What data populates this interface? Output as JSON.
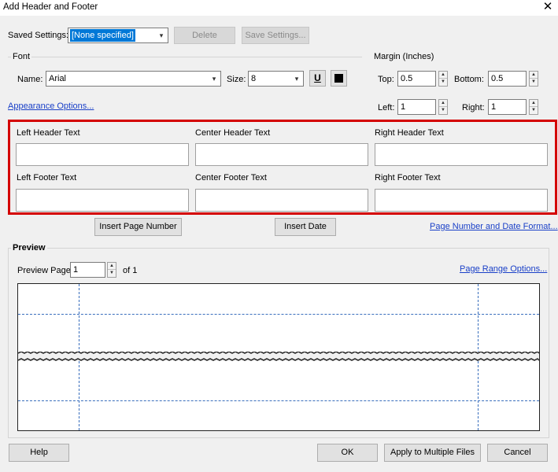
{
  "window": {
    "title": "Add Header and Footer",
    "close_icon": "close-icon"
  },
  "saved_settings": {
    "label": "Saved Settings:",
    "value": "[None specified]",
    "delete_label": "Delete",
    "save_label": "Save Settings..."
  },
  "font": {
    "group_label": "Font",
    "name_label": "Name:",
    "name_value": "Arial",
    "size_label": "Size:",
    "size_value": "8",
    "underline_glyph": "U",
    "color_hex": "#000000"
  },
  "margin": {
    "group_label": "Margin (Inches)",
    "top_label": "Top:",
    "top_value": "0.5",
    "bottom_label": "Bottom:",
    "bottom_value": "0.5",
    "left_label": "Left:",
    "left_value": "1",
    "right_label": "Right:",
    "right_value": "1"
  },
  "appearance_link": "Appearance Options...",
  "header_footer": {
    "left_header": "Left Header Text",
    "center_header": "Center Header Text",
    "right_header": "Right Header Text",
    "left_footer": "Left Footer Text",
    "center_footer": "Center Footer Text",
    "right_footer": "Right Footer Text"
  },
  "insert_page_number_label": "Insert Page Number",
  "insert_date_label": "Insert Date",
  "page_number_format_link": "Page Number and Date Format...",
  "preview": {
    "group_label": "Preview",
    "page_label": "Preview Page",
    "page_value": "1",
    "of_label": "of 1",
    "page_range_link": "Page Range Options..."
  },
  "footer_buttons": {
    "help": "Help",
    "ok": "OK",
    "apply_multiple": "Apply to Multiple Files",
    "cancel": "Cancel"
  },
  "colors": {
    "highlight": "#d40000",
    "link": "#1a40c8",
    "selection": "#0078d7"
  }
}
